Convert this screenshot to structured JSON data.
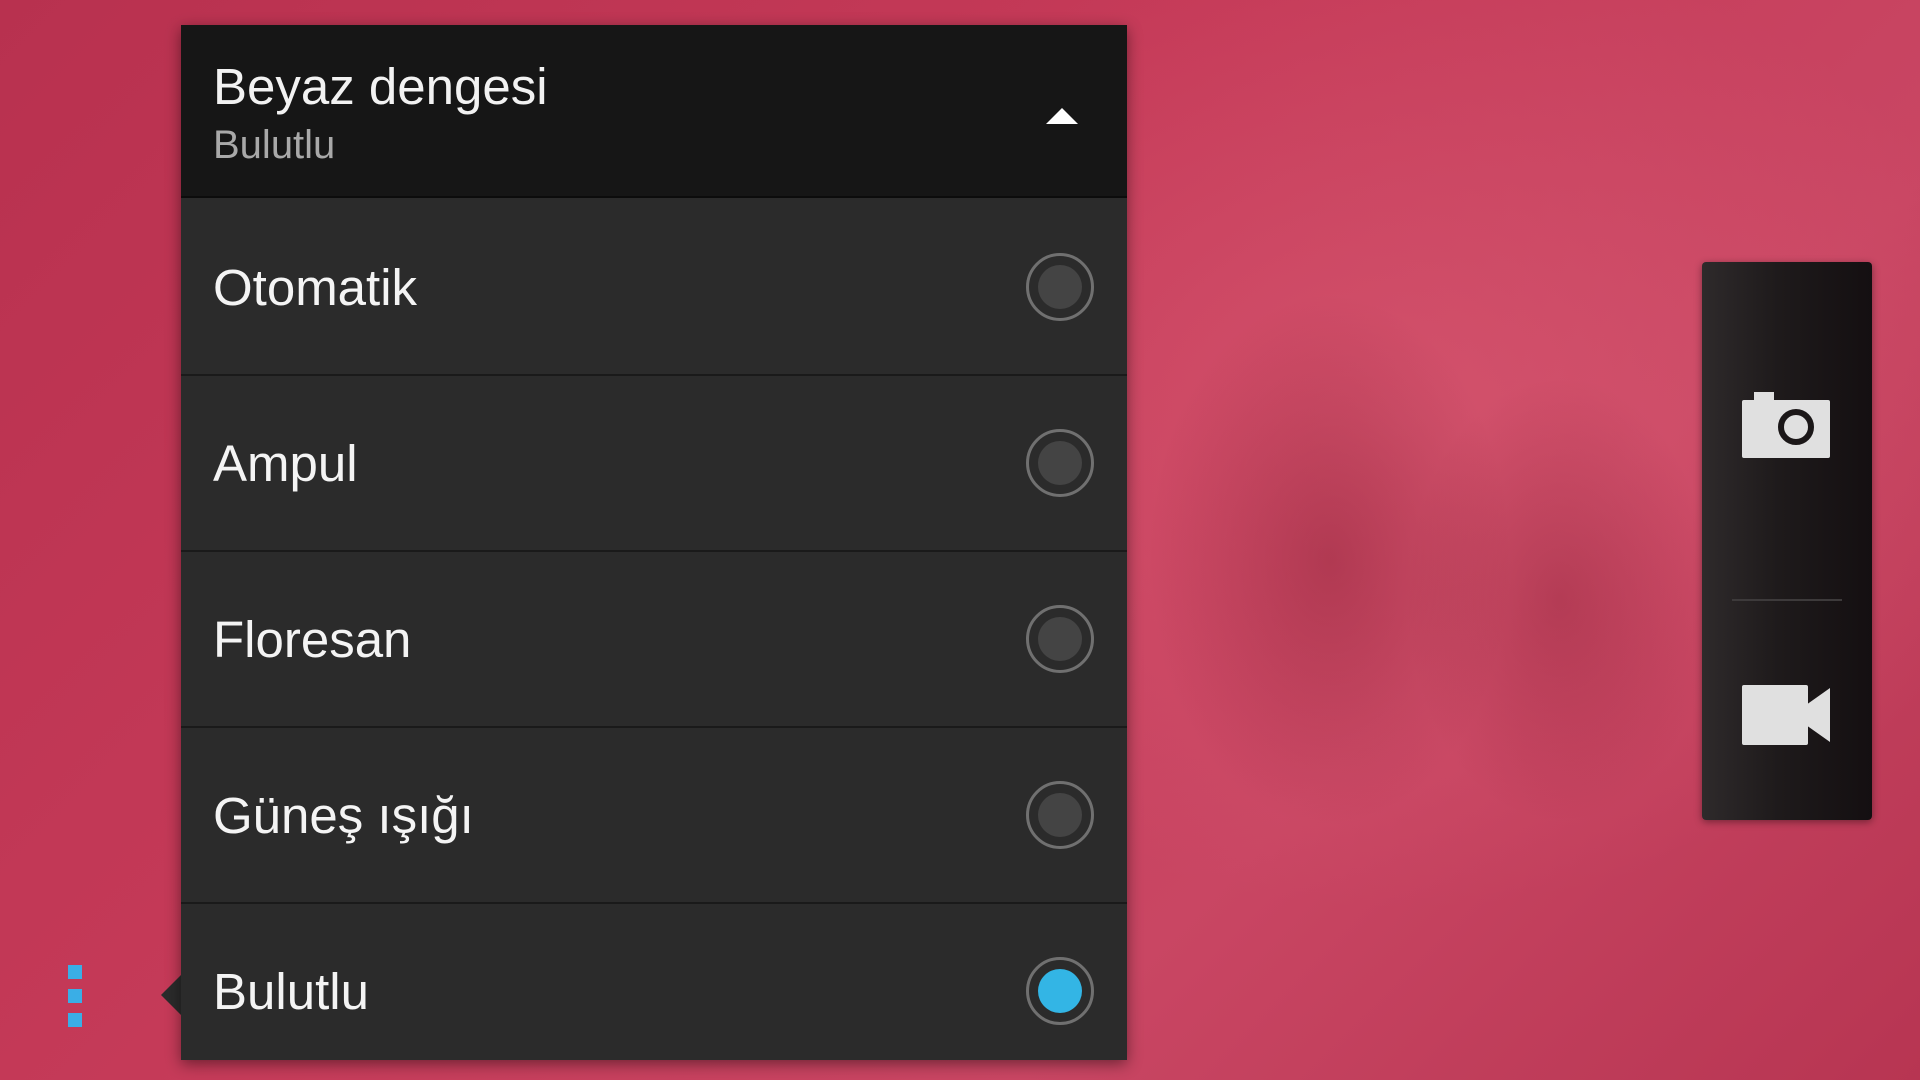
{
  "white_balance_menu": {
    "title": "Beyaz dengesi",
    "current_value": "Bulutlu",
    "collapse_icon": "chevron-up-icon",
    "options": [
      {
        "label": "Otomatik",
        "selected": false
      },
      {
        "label": "Ampul",
        "selected": false
      },
      {
        "label": "Floresan",
        "selected": false
      },
      {
        "label": "Güneş ışığı",
        "selected": false
      },
      {
        "label": "Bulutlu",
        "selected": true
      }
    ]
  },
  "side_menu": {
    "icon": "menu-dots-icon",
    "color": "#3aaee6"
  },
  "mode_switcher": {
    "modes": [
      {
        "icon": "camera-icon"
      },
      {
        "icon": "video-camera-icon"
      }
    ]
  },
  "colors": {
    "accent": "#33b5e5",
    "panel_bg": "#2b2b2b",
    "header_bg": "#161616"
  }
}
